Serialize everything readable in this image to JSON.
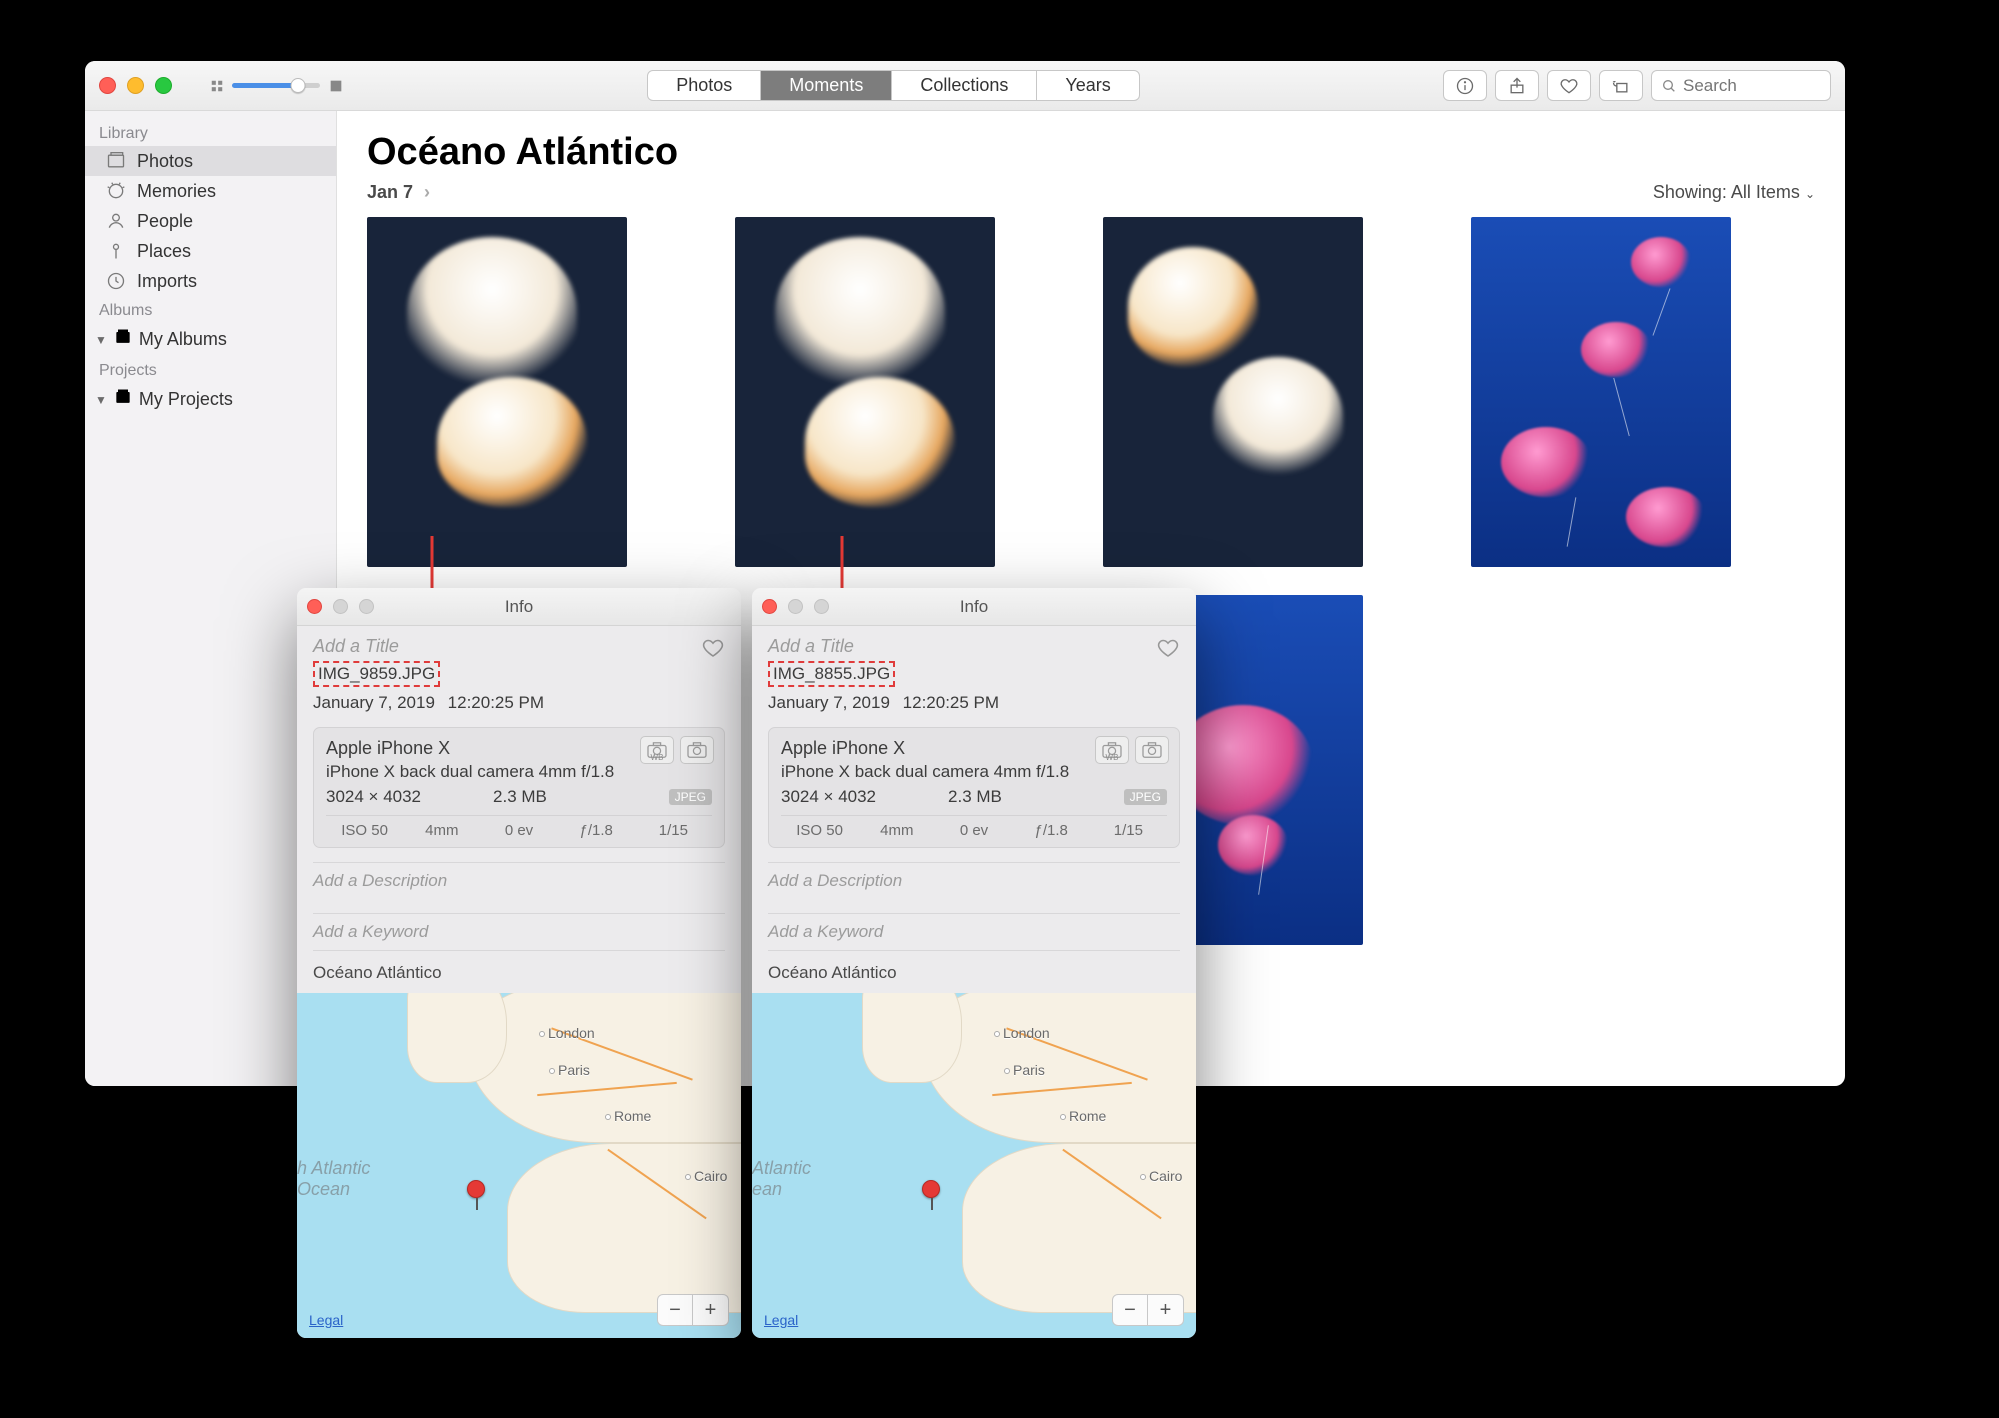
{
  "toolbar": {
    "segments": [
      "Photos",
      "Moments",
      "Collections",
      "Years"
    ],
    "active_segment": "Moments",
    "search_placeholder": "Search"
  },
  "sidebar": {
    "sections": {
      "library_label": "Library",
      "albums_label": "Albums",
      "projects_label": "Projects"
    },
    "library_items": [
      {
        "label": "Photos",
        "icon": "photos",
        "selected": true
      },
      {
        "label": "Memories",
        "icon": "memories",
        "selected": false
      },
      {
        "label": "People",
        "icon": "people",
        "selected": false
      },
      {
        "label": "Places",
        "icon": "places",
        "selected": false
      },
      {
        "label": "Imports",
        "icon": "imports",
        "selected": false
      }
    ],
    "albums_item": {
      "label": "My Albums"
    },
    "projects_item": {
      "label": "My Projects"
    }
  },
  "main": {
    "title": "Océano Atlántico",
    "subtitle_date": "Jan 7",
    "showing_label": "Showing:",
    "showing_value": "All Items"
  },
  "info_common": {
    "window_title": "Info",
    "add_title": "Add a Title",
    "add_description": "Add a Description",
    "add_keyword": "Add a Keyword",
    "legal": "Legal",
    "zoom_out": "−",
    "zoom_in": "+",
    "format_badge": "JPEG",
    "wb_label": "WB"
  },
  "info_panels": [
    {
      "filename": "IMG_9859.JPG",
      "date": "January 7, 2019",
      "time": "12:20:25 PM",
      "device": "Apple iPhone X",
      "lens": "iPhone X back dual camera 4mm f/1.8",
      "dimensions": "3024 × 4032",
      "filesize": "2.3 MB",
      "exif": {
        "iso": "ISO 50",
        "focal": "4mm",
        "ev": "0 ev",
        "aperture": "ƒ/1.8",
        "shutter": "1/15"
      },
      "location_name": "Océano Atlántico",
      "map_cities": [
        "London",
        "Paris",
        "Rome",
        "Cairo"
      ],
      "ocean_label": "h Atlantic\nOcean"
    },
    {
      "filename": "IMG_8855.JPG",
      "date": "January 7, 2019",
      "time": "12:20:25 PM",
      "device": "Apple iPhone X",
      "lens": "iPhone X back dual camera 4mm f/1.8",
      "dimensions": "3024 × 4032",
      "filesize": "2.3 MB",
      "exif": {
        "iso": "ISO 50",
        "focal": "4mm",
        "ev": "0 ev",
        "aperture": "ƒ/1.8",
        "shutter": "1/15"
      },
      "location_name": "Océano Atlántico",
      "map_cities": [
        "London",
        "Paris",
        "Rome",
        "Cairo"
      ],
      "ocean_label": "Atlantic\nean"
    }
  ]
}
